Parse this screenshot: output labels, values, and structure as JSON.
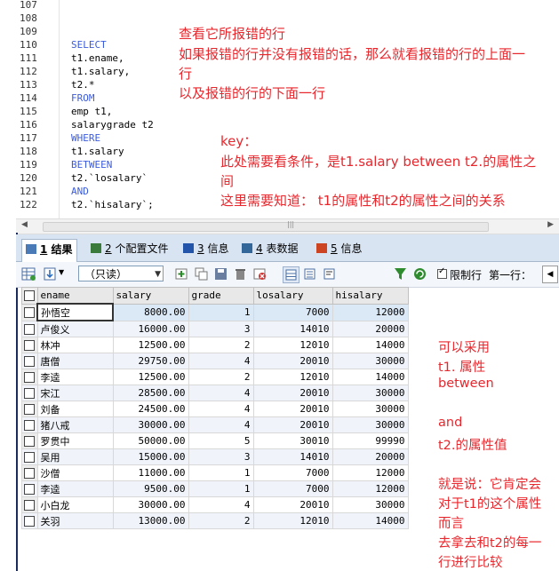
{
  "editor": {
    "lines": [
      {
        "n": "107",
        "code": ""
      },
      {
        "n": "108",
        "code": ""
      },
      {
        "n": "109",
        "code": ""
      },
      {
        "n": "110",
        "code": "SELECT",
        "kw": true
      },
      {
        "n": "111",
        "code": "t1.ename,"
      },
      {
        "n": "112",
        "code": "t1.salary,"
      },
      {
        "n": "113",
        "code": "t2.*"
      },
      {
        "n": "114",
        "code": "FROM",
        "kw": true
      },
      {
        "n": "115",
        "code": "emp t1,"
      },
      {
        "n": "116",
        "code": "salarygrade t2"
      },
      {
        "n": "117",
        "code": "WHERE",
        "kw": true
      },
      {
        "n": "118",
        "code": "t1.salary"
      },
      {
        "n": "119",
        "code": "BETWEEN",
        "kw": true
      },
      {
        "n": "120",
        "code": "t2.`losalary`"
      },
      {
        "n": "121",
        "code": "AND",
        "kw": true
      },
      {
        "n": "122",
        "code": "t2.`hisalary`;"
      }
    ],
    "note1": [
      "查看它所报错的行",
      "如果报错的行并没有报错的话，那么就看报错的行的上面一",
      "行",
      "以及报错的行的下面一行"
    ],
    "note2": [
      "key：",
      "此处需要看条件，是t1.salary between t2.的属性之",
      "间",
      "这里需要知道： t1的属性和t2的属性之间的关系"
    ]
  },
  "tabs": [
    {
      "num": "1",
      "label": "结果",
      "active": true,
      "color": "#4a7bb7"
    },
    {
      "num": "2",
      "label": "个配置文件",
      "active": false,
      "color": "#3a7a3a"
    },
    {
      "num": "3",
      "label": "信息",
      "active": false,
      "color": "#2255aa"
    },
    {
      "num": "4",
      "label": "表数据",
      "active": false,
      "color": "#336699"
    },
    {
      "num": "5",
      "label": "信息",
      "active": false,
      "color": "#cc4422"
    }
  ],
  "toolbar": {
    "mode_select": "（只读）",
    "limit_label": "限制行",
    "first_row_label": "第一行："
  },
  "grid": {
    "columns": [
      "ename",
      "salary",
      "grade",
      "losalary",
      "hisalary"
    ],
    "rows": [
      [
        "孙悟空",
        "8000.00",
        "1",
        "7000",
        "12000"
      ],
      [
        "卢俊义",
        "16000.00",
        "3",
        "14010",
        "20000"
      ],
      [
        "林冲",
        "12500.00",
        "2",
        "12010",
        "14000"
      ],
      [
        "唐僧",
        "29750.00",
        "4",
        "20010",
        "30000"
      ],
      [
        "李逵",
        "12500.00",
        "2",
        "12010",
        "14000"
      ],
      [
        "宋江",
        "28500.00",
        "4",
        "20010",
        "30000"
      ],
      [
        "刘备",
        "24500.00",
        "4",
        "20010",
        "30000"
      ],
      [
        "猪八戒",
        "30000.00",
        "4",
        "20010",
        "30000"
      ],
      [
        "罗贯中",
        "50000.00",
        "5",
        "30010",
        "99990"
      ],
      [
        "吴用",
        "15000.00",
        "3",
        "14010",
        "20000"
      ],
      [
        "沙僧",
        "11000.00",
        "1",
        "7000",
        "12000"
      ],
      [
        "李逵",
        "9500.00",
        "1",
        "7000",
        "12000"
      ],
      [
        "小白龙",
        "30000.00",
        "4",
        "20010",
        "30000"
      ],
      [
        "关羽",
        "13000.00",
        "2",
        "12010",
        "14000"
      ]
    ]
  },
  "side_note": [
    "可以采用",
    "t1. 属性",
    "between",
    "",
    "and",
    "t2.的属性值",
    "",
    "就是说：它肯定会",
    "对于t1的这个属性",
    "而言",
    "去拿去和t2的每一",
    "行进行比较"
  ]
}
